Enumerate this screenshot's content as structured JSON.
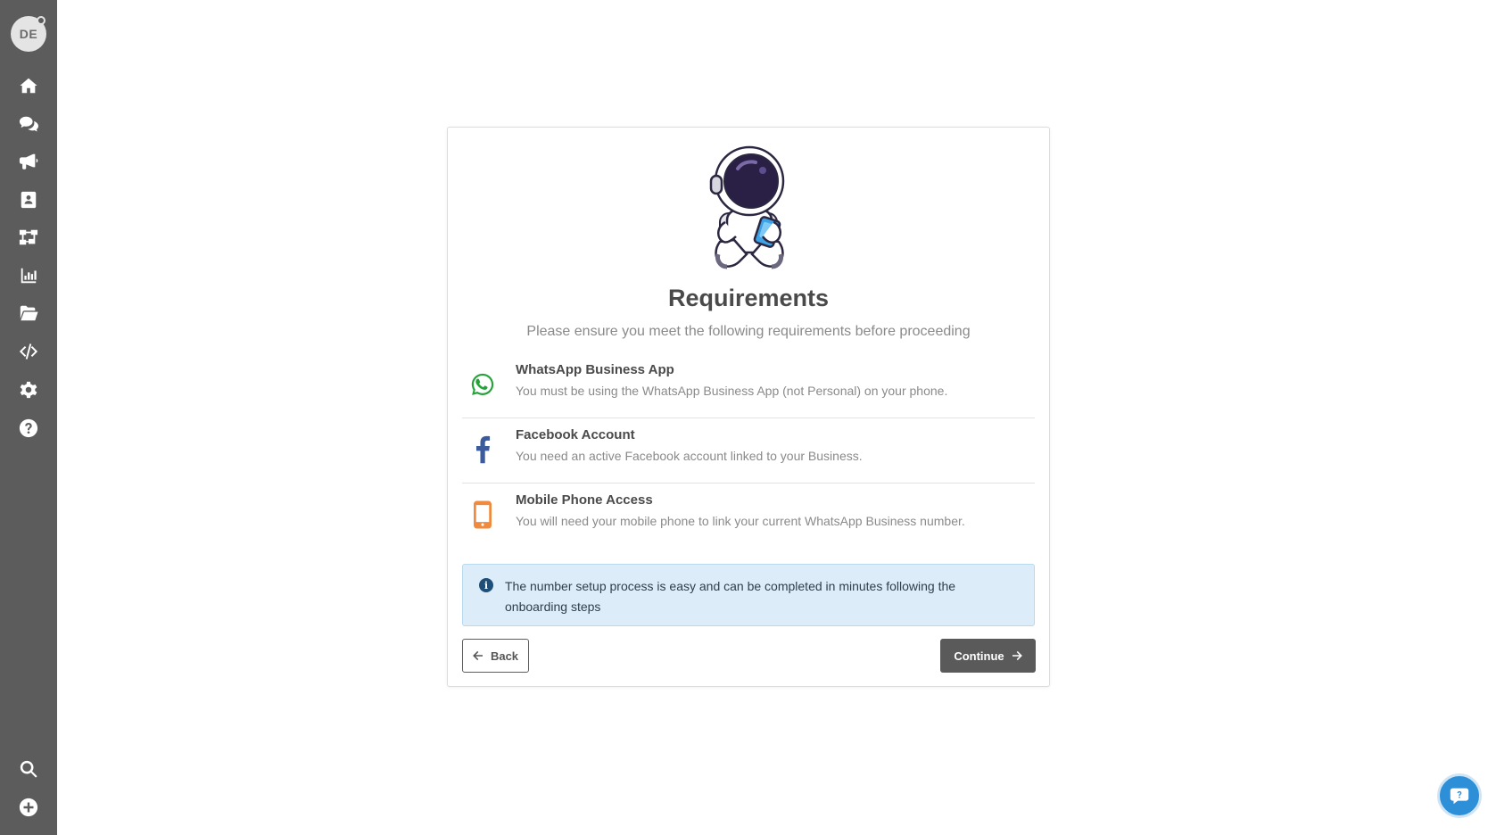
{
  "sidebar": {
    "avatar_initials": "DE",
    "top_items": [
      {
        "icon": "home-icon"
      },
      {
        "icon": "chat-icon"
      },
      {
        "icon": "megaphone-icon"
      },
      {
        "icon": "contacts-icon"
      },
      {
        "icon": "flow-icon"
      },
      {
        "icon": "analytics-icon"
      },
      {
        "icon": "folder-icon"
      },
      {
        "icon": "code-icon"
      },
      {
        "icon": "gear-icon"
      },
      {
        "icon": "help-icon"
      }
    ],
    "bottom_items": [
      {
        "icon": "search-icon"
      },
      {
        "icon": "add-icon"
      }
    ]
  },
  "card": {
    "title": "Requirements",
    "subtitle": "Please ensure you meet the following requirements before proceeding",
    "requirements": [
      {
        "icon": "whatsapp-icon",
        "title": "WhatsApp Business App",
        "description": "You must be using the WhatsApp Business App (not Personal) on your phone."
      },
      {
        "icon": "facebook-icon",
        "title": "Facebook Account",
        "description": "You need an active Facebook account linked to your Business."
      },
      {
        "icon": "mobile-phone-icon",
        "title": "Mobile Phone Access",
        "description": "You will need your mobile phone to link your current WhatsApp Business number."
      }
    ],
    "info_text": "The number setup process is easy and can be completed in minutes following the onboarding steps",
    "back_label": "Back",
    "continue_label": "Continue"
  },
  "colors": {
    "sidebar_bg": "#5c5c5c",
    "whatsapp": "#25a33a",
    "facebook": "#3b5b9c",
    "phone": "#f08a3c",
    "info_bg": "#dcedf9",
    "continue_bg": "#5a5a5a",
    "help_bubble": "#2d8fd8"
  }
}
